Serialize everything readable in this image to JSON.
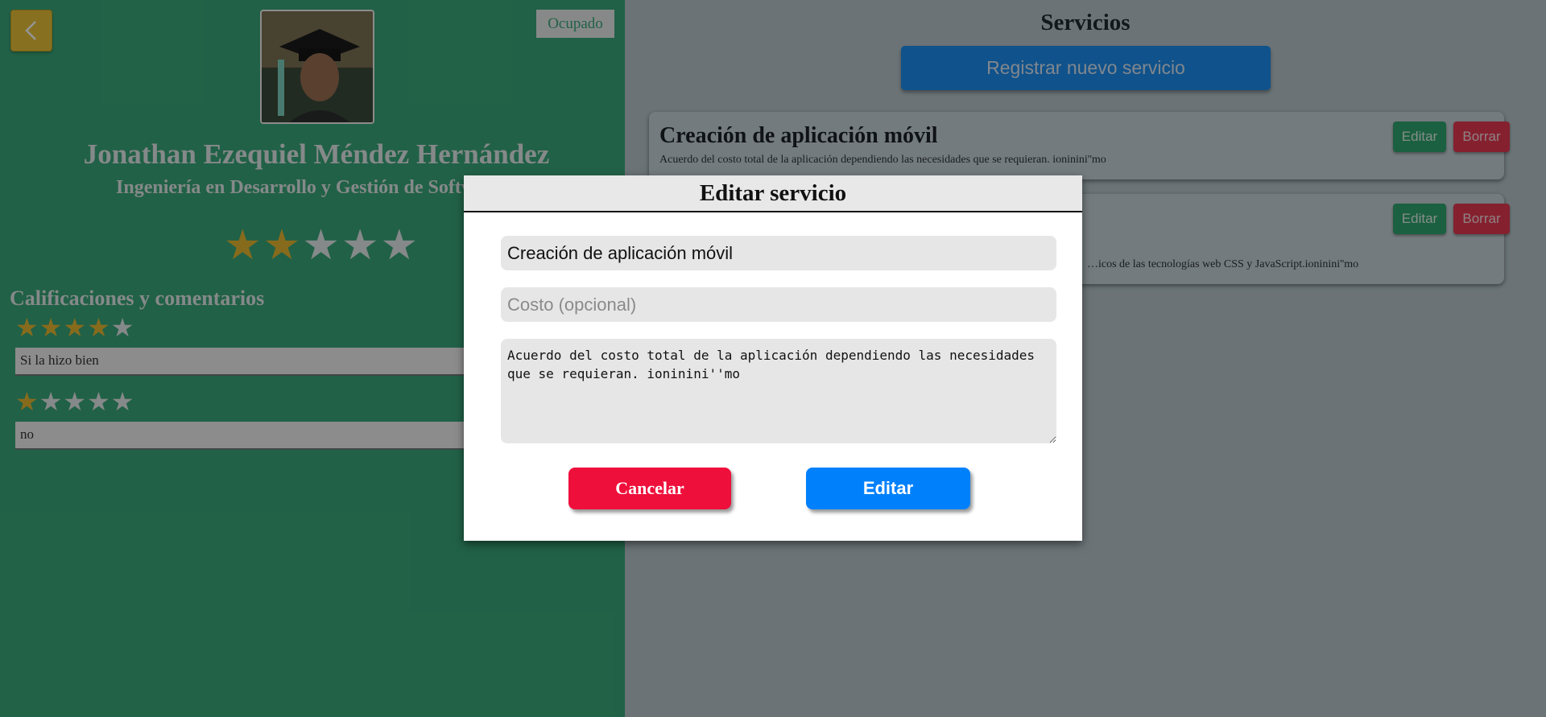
{
  "profile": {
    "status": "Ocupado",
    "name": "Jonathan Ezequiel Méndez Hernández",
    "career": "Ingeniería en Desarrollo y Gestión de Software",
    "rating": 2,
    "rating_max": 5
  },
  "reviews": {
    "title": "Calificaciones y comentarios",
    "items": [
      {
        "rating": 4,
        "comment": "Si la hizo bien"
      },
      {
        "rating": 1,
        "comment": "no"
      }
    ]
  },
  "services": {
    "title": "Servicios",
    "register_label": "Registrar nuevo servicio",
    "items": [
      {
        "title": "Creación de aplicación móvil",
        "description": "Acuerdo del costo total de la aplicación dependiendo las necesidades que se requieran. ioninini''mo",
        "edit_label": "Editar",
        "delete_label": "Borrar"
      },
      {
        "title": "",
        "description": "…icos de las tecnologías web CSS y JavaScript.ioninini''mo",
        "edit_label": "Editar",
        "delete_label": "Borrar"
      }
    ]
  },
  "modal": {
    "title": "Editar servicio",
    "name_value": "Creación de aplicación móvil",
    "cost_placeholder": "Costo (opcional)",
    "description_value": "Acuerdo del costo total de la aplicación dependiendo las necesidades que se requieran. ioninini''mo",
    "cancel_label": "Cancelar",
    "submit_label": "Editar"
  },
  "colors": {
    "left_panel": "#3aa87a",
    "accent_gold": "#e8b931",
    "primary_blue": "#0081fb",
    "danger_red": "#ef0f3b"
  }
}
